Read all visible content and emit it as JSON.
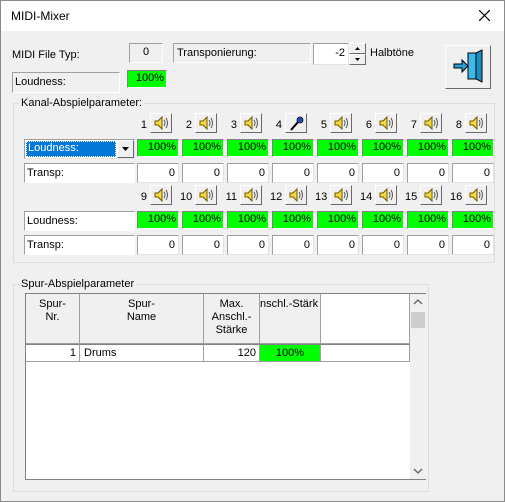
{
  "window": {
    "title": "MIDI-Mixer"
  },
  "header": {
    "file_type_label": "MIDI File Typ:",
    "file_type_value": "0",
    "transpose_label": "Transponierung:",
    "transpose_value": "-2",
    "halftones_label": "Halbtöne",
    "loudness_label": "Loudness:",
    "loudness_value": "100%",
    "exit_icon": "exit-door-icon"
  },
  "channels": {
    "group_title": "Kanal-Abspielparameter:",
    "mode_select_value": "Loudness:",
    "transp_label": "Transp:",
    "loudness_label": "Loudness:",
    "row1": [
      {
        "num": "1",
        "icon": "speaker-icon",
        "loud": "100%",
        "transp": "0"
      },
      {
        "num": "2",
        "icon": "speaker-icon",
        "loud": "100%",
        "transp": "0"
      },
      {
        "num": "3",
        "icon": "speaker-icon",
        "loud": "100%",
        "transp": "0"
      },
      {
        "num": "4",
        "icon": "microphone-icon",
        "loud": "100%",
        "transp": "0"
      },
      {
        "num": "5",
        "icon": "speaker-icon",
        "loud": "100%",
        "transp": "0"
      },
      {
        "num": "6",
        "icon": "speaker-icon",
        "loud": "100%",
        "transp": "0"
      },
      {
        "num": "7",
        "icon": "speaker-icon",
        "loud": "100%",
        "transp": "0"
      },
      {
        "num": "8",
        "icon": "speaker-icon",
        "loud": "100%",
        "transp": "0"
      }
    ],
    "row2": [
      {
        "num": "9",
        "icon": "speaker-icon",
        "loud": "100%",
        "transp": "0"
      },
      {
        "num": "10",
        "icon": "speaker-icon",
        "loud": "100%",
        "transp": "0"
      },
      {
        "num": "11",
        "icon": "speaker-icon",
        "loud": "100%",
        "transp": "0"
      },
      {
        "num": "12",
        "icon": "speaker-icon",
        "loud": "100%",
        "transp": "0"
      },
      {
        "num": "13",
        "icon": "speaker-icon",
        "loud": "100%",
        "transp": "0"
      },
      {
        "num": "14",
        "icon": "speaker-icon",
        "loud": "100%",
        "transp": "0"
      },
      {
        "num": "15",
        "icon": "speaker-icon",
        "loud": "100%",
        "transp": "0"
      },
      {
        "num": "16",
        "icon": "speaker-icon",
        "loud": "100%",
        "transp": "0"
      }
    ]
  },
  "tracks": {
    "group_title": "Spur-Abspielparameter",
    "columns": [
      "Spur-\nNr.",
      "Spur-\nName",
      "Max.\nAnschl.-\nStärke",
      "nschl.-Stärk"
    ],
    "rows": [
      {
        "nr": "1",
        "name": "Drums",
        "max": "120",
        "strength": "100%"
      }
    ]
  },
  "colors": {
    "green": "#00ff00",
    "face": "#f0f0f0",
    "exit_arrow": "#2a9fd6"
  }
}
